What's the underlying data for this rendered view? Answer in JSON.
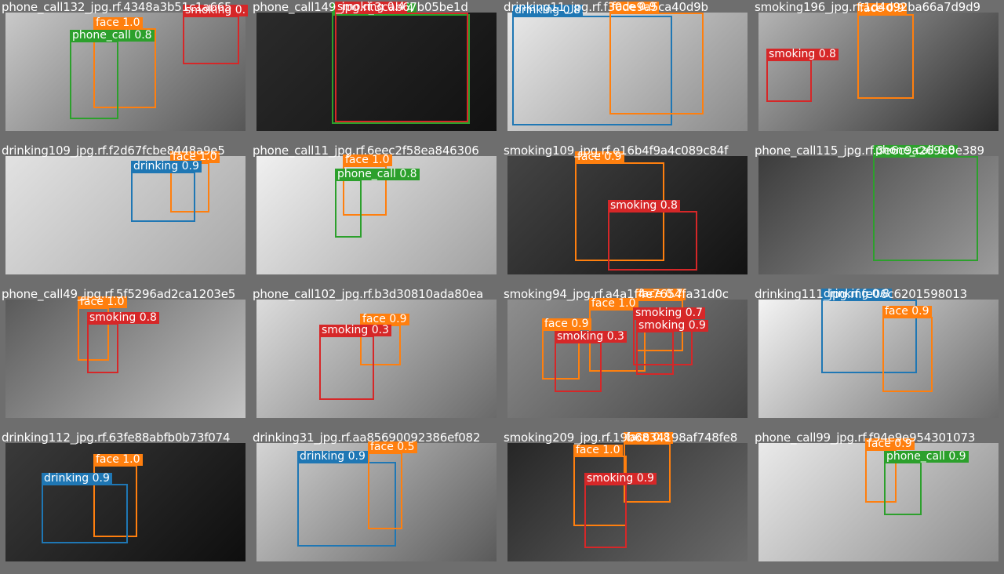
{
  "colors": {
    "face": "#ff7f0e",
    "phone_call": "#2ca02c",
    "smoking": "#d62728",
    "drinking": "#1f77b4"
  },
  "tiles": [
    {
      "title": "phone_call132_jpg.rf.4348a3b51c1a665",
      "tone": [
        "#c9c9c9",
        "#565656"
      ],
      "boxes": [
        {
          "cls": "face",
          "text": "face 1.0"
        },
        {
          "cls": "phone_call",
          "text": "phone_call 0.8"
        },
        {
          "cls": "smoking",
          "text": "smoking 0."
        }
      ]
    },
    {
      "title": "phone_call149_jpg.rf.3cab67b05be1d",
      "tone": [
        "#2b2b2b",
        "#111111"
      ],
      "boxes": [
        {
          "cls": "phone_call",
          "text": "phone_call 0.4"
        },
        {
          "cls": "smoking",
          "text": "smoking 0.4"
        }
      ]
    },
    {
      "title": "drinking11_jpg.rf.f30de9a5ca40d9b",
      "tone": [
        "#e9e9e9",
        "#8a8a8a"
      ],
      "boxes": [
        {
          "cls": "drinking",
          "text": "drinking 0.8"
        },
        {
          "cls": "face",
          "text": "face 0.9"
        }
      ]
    },
    {
      "title": "smoking196_jpg.rf.1d4d92ba66a7d9d9",
      "tone": [
        "#b4b4b4",
        "#2a2a2a"
      ],
      "boxes": [
        {
          "cls": "face",
          "text": "face 0.9"
        },
        {
          "cls": "smoking",
          "text": "smoking 0.8"
        }
      ]
    },
    {
      "title": "drinking109_jpg.rf.f2d67fcbe8448a9e5",
      "tone": [
        "#e2e2e2",
        "#a8a8a8"
      ],
      "boxes": [
        {
          "cls": "face",
          "text": "face 1.0"
        },
        {
          "cls": "drinking",
          "text": "drinking 0.9"
        }
      ]
    },
    {
      "title": "phone_call11_jpg.rf.6eec2f58ea846306",
      "tone": [
        "#f0f0f0",
        "#a0a0a0"
      ],
      "boxes": [
        {
          "cls": "face",
          "text": "face 1.0"
        },
        {
          "cls": "phone_call",
          "text": "phone_call 0.8"
        }
      ]
    },
    {
      "title": "smoking109_jpg.rf.e16b4f9a4c089c84f",
      "tone": [
        "#444444",
        "#121212"
      ],
      "boxes": [
        {
          "cls": "face",
          "text": "face 0.9"
        },
        {
          "cls": "smoking",
          "text": "smoking 0.8"
        }
      ]
    },
    {
      "title": "phone_call115_jpg.rf.3e6c9a269e0e389",
      "tone": [
        "#3c3c3c",
        "#9c9c9c"
      ],
      "boxes": [
        {
          "cls": "phone_call",
          "text": "phone_call 0.8"
        }
      ]
    },
    {
      "title": "phone_call49_jpg.rf.5f5296ad2ca1203e5",
      "tone": [
        "#5a5a5a",
        "#c4c4c4"
      ],
      "boxes": [
        {
          "cls": "face",
          "text": "face 1.0"
        },
        {
          "cls": "smoking",
          "text": "smoking 0.8"
        }
      ]
    },
    {
      "title": "phone_call102_jpg.rf.b3d30810ada80ea",
      "tone": [
        "#dcdcdc",
        "#6a6a6a"
      ],
      "boxes": [
        {
          "cls": "face",
          "text": "face 0.9"
        },
        {
          "cls": "smoking",
          "text": "smoking 0.3"
        }
      ]
    },
    {
      "title": "smoking94_jpg.rf.a4a1f4e7654fa31d0c",
      "tone": [
        "#8e8e8e",
        "#444444"
      ],
      "boxes": [
        {
          "cls": "face",
          "text": "face 0.7"
        },
        {
          "cls": "face",
          "text": "face 1.0"
        },
        {
          "cls": "smoking",
          "text": "smoking 0.7"
        },
        {
          "cls": "face",
          "text": "face 0.9"
        },
        {
          "cls": "smoking",
          "text": "smoking 0.3"
        },
        {
          "cls": "smoking",
          "text": "smoking 0.9"
        }
      ]
    },
    {
      "title": "drinking111_jpg.rf.fe06c6201598013",
      "tone": [
        "#f4f4f4",
        "#6b6b6b"
      ],
      "boxes": [
        {
          "cls": "drinking",
          "text": "drinking 0.8"
        },
        {
          "cls": "face",
          "text": "face 0.9"
        }
      ]
    },
    {
      "title": "drinking112_jpg.rf.63fe88abfb0b73f074",
      "tone": [
        "#3a3a3a",
        "#0e0e0e"
      ],
      "boxes": [
        {
          "cls": "face",
          "text": "face 1.0"
        },
        {
          "cls": "drinking",
          "text": "drinking 0.9"
        }
      ]
    },
    {
      "title": "drinking31_jpg.rf.aa85690092386ef082",
      "tone": [
        "#d4d4d4",
        "#5a5a5a"
      ],
      "boxes": [
        {
          "cls": "drinking",
          "text": "drinking 0.9"
        },
        {
          "cls": "face",
          "text": "face 0.5"
        }
      ]
    },
    {
      "title": "smoking209_jpg.rf.19b6834198af748fe8",
      "tone": [
        "#262626",
        "#6a6a6a"
      ],
      "boxes": [
        {
          "cls": "face",
          "text": "face 0.8"
        },
        {
          "cls": "face",
          "text": "face 1.0"
        },
        {
          "cls": "smoking",
          "text": "smoking 0.9"
        }
      ]
    },
    {
      "title": "phone_call99_jpg.rf.f94e9e954301073",
      "tone": [
        "#eaeaea",
        "#8c8c8c"
      ],
      "boxes": [
        {
          "cls": "face",
          "text": "face 0.9"
        },
        {
          "cls": "phone_call",
          "text": "phone_call 0.9"
        }
      ]
    }
  ]
}
